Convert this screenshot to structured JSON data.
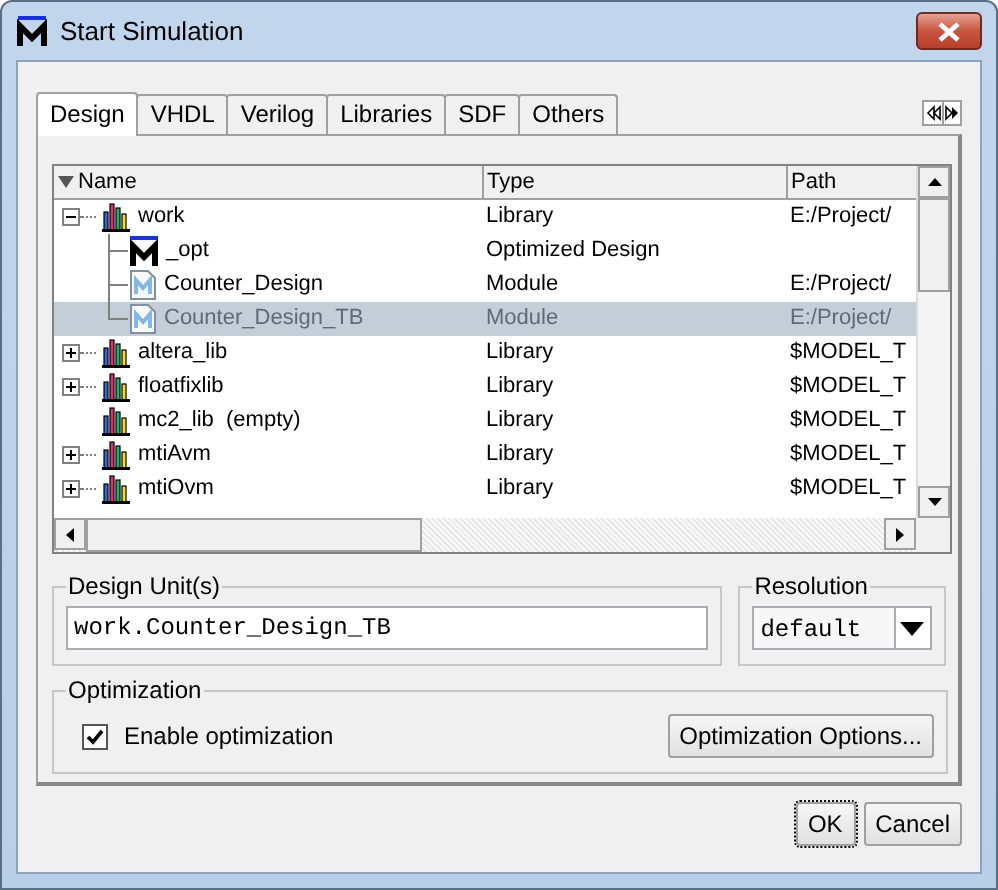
{
  "window": {
    "title": "Start Simulation"
  },
  "tabs": [
    {
      "label": "Design",
      "selected": true
    },
    {
      "label": "VHDL",
      "selected": false
    },
    {
      "label": "Verilog",
      "selected": false
    },
    {
      "label": "Libraries",
      "selected": false
    },
    {
      "label": "SDF",
      "selected": false
    },
    {
      "label": "Others",
      "selected": false
    }
  ],
  "tree": {
    "columns": [
      "Name",
      "Type",
      "Path"
    ],
    "items": [
      {
        "name": "work",
        "type": "Library",
        "path": "E:/Project/",
        "kind": "library",
        "expanded": true,
        "selected": false,
        "children": [
          {
            "name": "_opt",
            "type": "Optimized Design",
            "kind": "optimized",
            "selected": false
          },
          {
            "name": "Counter_Design",
            "type": "Module",
            "path": "E:/Project/",
            "kind": "module",
            "selected": false
          },
          {
            "name": "Counter_Design_TB",
            "type": "Module",
            "path": "E:/Project/",
            "kind": "module",
            "selected": true
          }
        ]
      },
      {
        "name": "altera_lib",
        "type": "Library",
        "path": "$MODEL_T",
        "kind": "library",
        "expanded": false,
        "selected": false
      },
      {
        "name": "floatfixlib",
        "type": "Library",
        "path": "$MODEL_T",
        "kind": "library",
        "expanded": false,
        "selected": false
      },
      {
        "name": "mc2_lib  (empty)",
        "type": "Library",
        "path": "$MODEL_T",
        "kind": "library",
        "selected": false
      },
      {
        "name": "mtiAvm",
        "type": "Library",
        "path": "$MODEL_T",
        "kind": "library",
        "expanded": false,
        "selected": false
      },
      {
        "name": "mtiOvm",
        "type": "Library",
        "path": "$MODEL_T",
        "kind": "library",
        "expanded": false,
        "selected": false
      }
    ]
  },
  "design_units": {
    "label": "Design Unit(s)",
    "value": "work.Counter_Design_TB"
  },
  "resolution": {
    "label": "Resolution",
    "value": "default"
  },
  "optimization": {
    "label": "Optimization",
    "checkbox": {
      "label": "Enable optimization",
      "checked": true
    },
    "button": "Optimization Options..."
  },
  "buttons": [
    "OK",
    "Cancel"
  ]
}
